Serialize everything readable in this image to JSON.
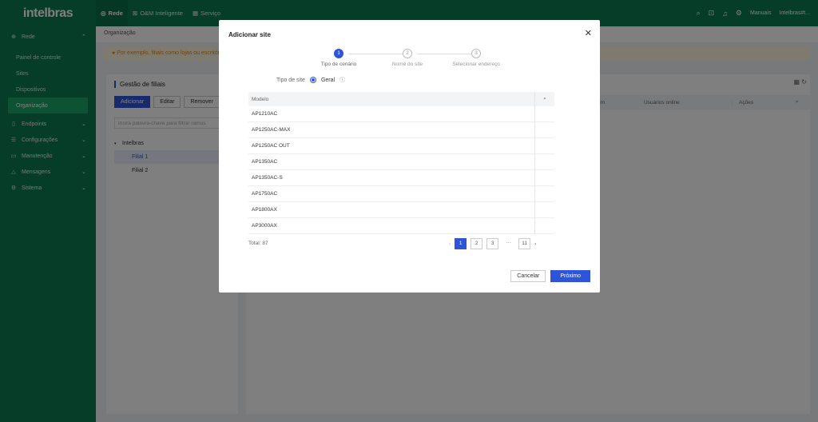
{
  "brand": "intelbras",
  "topnav": [
    {
      "label": "Rede",
      "icon": "network-icon"
    },
    {
      "label": "O&M Inteligente",
      "icon": "tools-icon"
    },
    {
      "label": "Serviço",
      "icon": "service-icon"
    }
  ],
  "topright": {
    "manuals": "Manuais",
    "user": "Intelbras#t..."
  },
  "sidebar": {
    "rede": "Rede",
    "subs": [
      "Painel de controle",
      "Sites",
      "Dispositivos",
      "Organização"
    ],
    "groups": [
      "Endpoints",
      "Configurações",
      "Manutenção",
      "Mensagens",
      "Sistema"
    ]
  },
  "breadcrumb": "Organização",
  "notice": "Por exemplo, filiais como lojas ou escritórios",
  "left_panel": {
    "title": "Gestão de filiais",
    "buttons": [
      "Adicionar",
      "Editar",
      "Remover"
    ],
    "filter_placeholder": "Insira palavra-chave para filtrar ramos",
    "tree": [
      "Intelbras",
      "Filial 1",
      "Filial 2"
    ]
  },
  "right_panel": {
    "col_users": "Usuários online",
    "col_actions": "Ações",
    "col_partial": "em"
  },
  "modal": {
    "title": "Adicionar site",
    "steps": [
      {
        "num": "1",
        "label": "Tipo de cenário"
      },
      {
        "num": "2",
        "label": "Nome do site"
      },
      {
        "num": "3",
        "label": "Selecionar endereço"
      }
    ],
    "site_type_label": "Tipo de site",
    "site_type_value": "Geral",
    "table_header": "Modelo",
    "rows": [
      "AP1210AC",
      "AP1250AC-MAX",
      "AP1250AC OUT",
      "AP1350AC",
      "AP1350AC-S",
      "AP1750AC",
      "AP1800AX",
      "AP3000AX"
    ],
    "total": "Total: 87",
    "pages": [
      "1",
      "2",
      "3",
      "···",
      "11"
    ],
    "cancel": "Cancelar",
    "next": "Próximo"
  }
}
